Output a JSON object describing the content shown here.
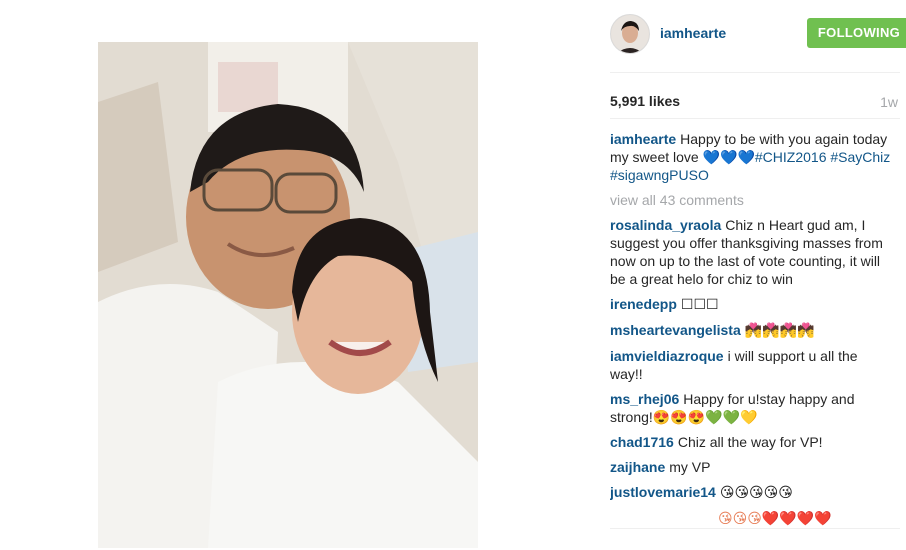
{
  "post": {
    "username": "iamhearte",
    "follow_label": "FOLLOWING",
    "likes": "5,991 likes",
    "time_ago": "1w",
    "caption": {
      "username": "iamhearte",
      "text": "Happy to be with you again today my sweet love 💙💙💙",
      "hashtags": "#CHIZ2016 #SayChiz #sigawngPUSO"
    },
    "view_all_label": "view all 43 comments"
  },
  "comments": [
    {
      "user": "rosalinda_yraola",
      "text": "Chiz n Heart gud am, I suggest you offer thanksgiving masses from now on up to the last of vote counting, it will be a great helo for chiz to win"
    },
    {
      "user": "irenedepp",
      "text": "☐☐☐"
    },
    {
      "user": "msheartevangelista",
      "text": "💏💏💏💏"
    },
    {
      "user": "iamvieldiazroque",
      "text": "i will support u all the way!!"
    },
    {
      "user": "ms_rhej06",
      "text": "Happy for u!stay happy and strong!😍😍😍💚💚💛"
    },
    {
      "user": "chad1716",
      "text": "Chiz all the way for VP!"
    },
    {
      "user": "zaijhane",
      "text": "my VP"
    },
    {
      "user": "justlovemarie14",
      "text": "😘😘😘😘😘"
    }
  ],
  "partial_comment_emojis": "😘😘😘❤️❤️❤️❤️",
  "colors": {
    "username_link": "#125688",
    "follow_button": "#70c050",
    "muted_text": "#a5a7aa",
    "body_text": "#262626"
  }
}
